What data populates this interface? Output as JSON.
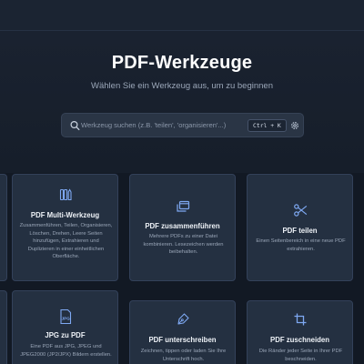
{
  "header": {
    "title": "PDF-Werkzeuge",
    "subtitle": "Wählen Sie ein Werkzeug aus, um zu beginnen"
  },
  "search": {
    "placeholder": "Werkzeug suchen (z.B. 'teilen', 'organisieren'...)",
    "shortcut": "Ctrl + K",
    "search_icon": "search-icon",
    "settings_icon": "gear-icon"
  },
  "accent_color": "#7ea8f2",
  "tools": [
    {
      "title": "PDF Multi-Werkzeug",
      "description": "Zusammenführen, Teilen, Organisieren, Löschen, Drehen, Leere Seiten hinzufügen, Extrahieren und Duplizieren in einer einheitlichen Oberfläche.",
      "icon": "toolbox-icon"
    },
    {
      "title": "PDF zusammenführen",
      "description": "Mehrere PDFs zu einer Datei kombinieren. Lesezeichen werden beibehalten.",
      "icon": "merge-pages-icon"
    },
    {
      "title": "PDF teilen",
      "description": "Einen Seitenbereich in eine neue PDF extrahieren.",
      "icon": "scissors-icon"
    },
    {
      "title": "JPG zu PDF",
      "description": "Eine PDF aus JPG, JPEG und JPEG2000 (JP2/JPX) Bildern erstellen.",
      "icon": "jpg-file-icon"
    },
    {
      "title": "PDF unterschreiben",
      "description": "Zeichnen, tippen oder laden Sie Ihre Unterschrift hoch.",
      "icon": "pen-nib-icon"
    },
    {
      "title": "PDF zuschneiden",
      "description": "Die Ränder jeder Seite in Ihrer PDF beschneiden.",
      "icon": "crop-icon"
    }
  ]
}
